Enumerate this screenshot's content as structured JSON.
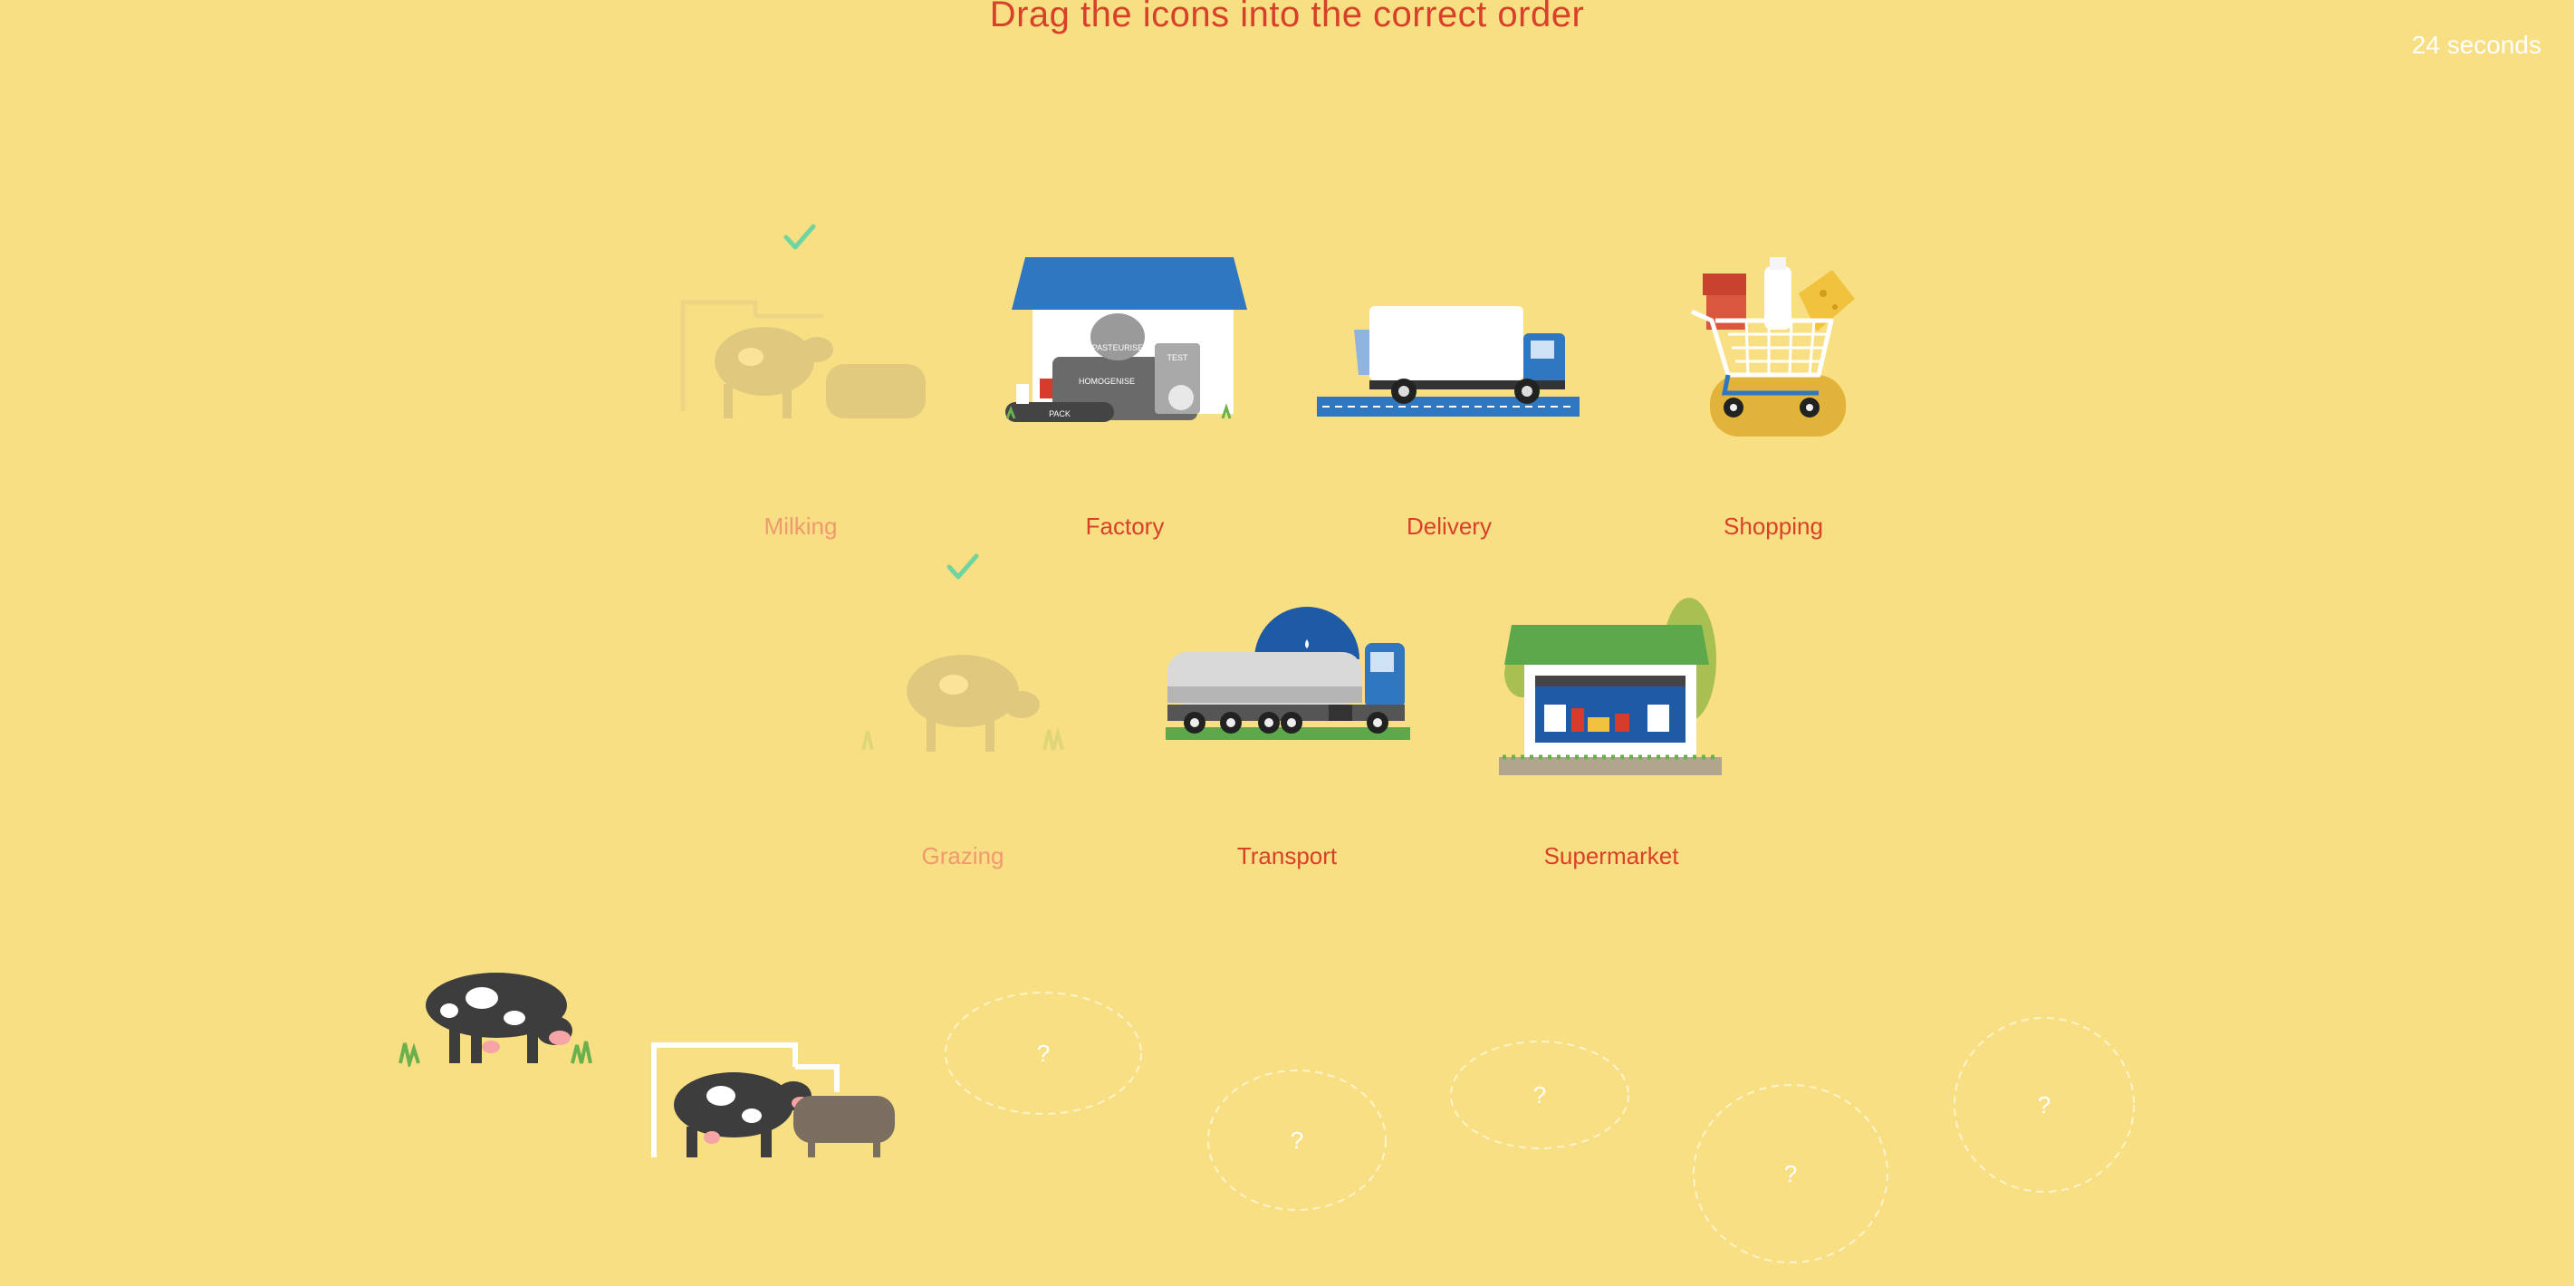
{
  "header": {
    "title": "Drag the icons into the correct order"
  },
  "timer": {
    "text": "24 seconds"
  },
  "cards": [
    {
      "label": "Milking",
      "icon": "milking-cow-icon",
      "status": "placed"
    },
    {
      "label": "Factory",
      "icon": "factory-icon",
      "status": "pending",
      "signs": {
        "pasteurise": "PASTEURISE",
        "homogenise": "HOMOGENISE",
        "test": "TEST",
        "pack": "PACK"
      }
    },
    {
      "label": "Delivery",
      "icon": "delivery-truck-icon",
      "status": "pending"
    },
    {
      "label": "Shopping",
      "icon": "shopping-cart-icon",
      "status": "pending"
    },
    {
      "label": "Grazing",
      "icon": "grazing-cow-icon",
      "status": "placed"
    },
    {
      "label": "Transport",
      "icon": "tanker-truck-icon",
      "status": "pending"
    },
    {
      "label": "Supermarket",
      "icon": "supermarket-icon",
      "status": "pending"
    }
  ],
  "slots": [
    "?",
    "?",
    "?",
    "?",
    "?"
  ],
  "colors": {
    "background": "#f9df84",
    "accent": "#d9402a",
    "check": "#6ed4a0"
  }
}
